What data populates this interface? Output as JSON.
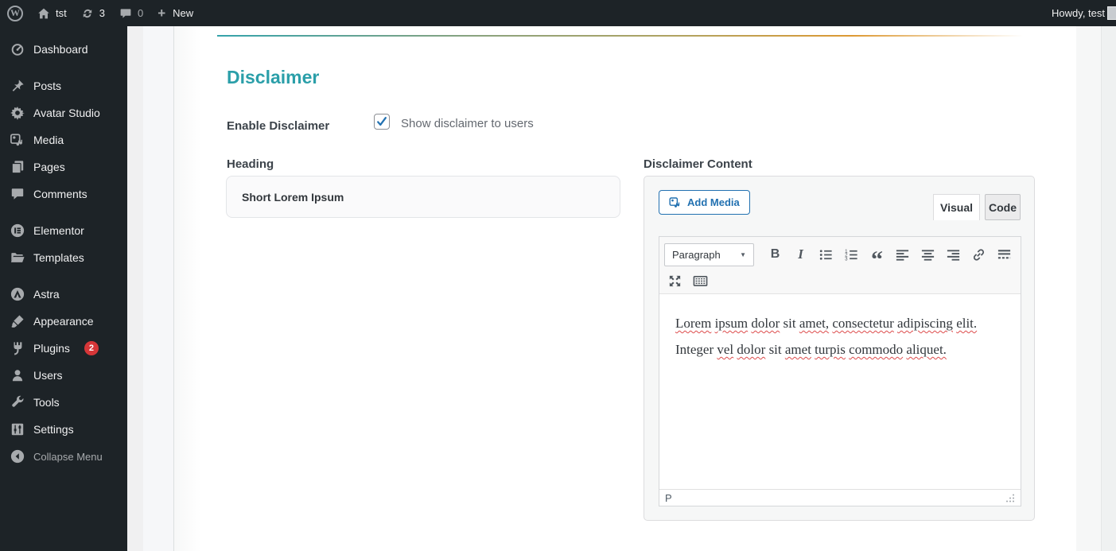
{
  "admin_bar": {
    "site_name": "tst",
    "updates_count": "3",
    "comments_count": "0",
    "new_label": "New",
    "howdy": "Howdy, test"
  },
  "sidebar": {
    "items": [
      {
        "label": "Dashboard",
        "icon": "dashboard",
        "slug": "dashboard"
      },
      {
        "label": "Posts",
        "icon": "pin",
        "slug": "posts",
        "sep": true
      },
      {
        "label": "Avatar Studio",
        "icon": "gear",
        "slug": "avatar-studio"
      },
      {
        "label": "Media",
        "icon": "media",
        "slug": "media"
      },
      {
        "label": "Pages",
        "icon": "pages",
        "slug": "pages"
      },
      {
        "label": "Comments",
        "icon": "comment",
        "slug": "comments"
      },
      {
        "label": "Elementor",
        "icon": "elementor",
        "slug": "elementor",
        "sep": true
      },
      {
        "label": "Templates",
        "icon": "folder",
        "slug": "templates"
      },
      {
        "label": "Astra",
        "icon": "astra",
        "slug": "astra",
        "sep": true
      },
      {
        "label": "Appearance",
        "icon": "brush",
        "slug": "appearance"
      },
      {
        "label": "Plugins",
        "icon": "plug",
        "slug": "plugins",
        "badge": "2"
      },
      {
        "label": "Users",
        "icon": "user",
        "slug": "users"
      },
      {
        "label": "Tools",
        "icon": "wrench",
        "slug": "tools"
      },
      {
        "label": "Settings",
        "icon": "sliders",
        "slug": "settings"
      },
      {
        "label": "Collapse Menu",
        "icon": "collapse",
        "slug": "collapse-menu",
        "muted": true
      }
    ]
  },
  "panel": {
    "title": "Disclaimer",
    "enable_field": {
      "label": "Enable Disclaimer",
      "checkbox_label": "Show disclaimer to users",
      "checked": true
    },
    "heading_field": {
      "label": "Heading",
      "value": "Short Lorem Ipsum"
    },
    "content_field": {
      "label": "Disclaimer Content",
      "add_media_label": "Add Media",
      "tab_visual": "Visual",
      "tab_code": "Code",
      "active_tab": "Visual",
      "block_format": "Paragraph",
      "bold_glyph": "B",
      "italic_glyph": "I",
      "status_path": "P",
      "text": "Lorem ipsum dolor sit amet, consectetur adipiscing elit. Integer vel dolor sit amet turpis commodo aliquet.",
      "words": [
        {
          "t": "Lorem",
          "m": true
        },
        {
          "t": "ipsum",
          "m": true
        },
        {
          "t": "dolor",
          "m": true
        },
        {
          "t": "sit",
          "m": false
        },
        {
          "t": "amet,",
          "m": true
        },
        {
          "t": "consectetur",
          "m": true
        },
        {
          "t": "adipiscing",
          "m": true
        },
        {
          "t": "elit.",
          "m": true
        },
        {
          "t": "Integer",
          "m": false
        },
        {
          "t": "vel",
          "m": true
        },
        {
          "t": "dolor",
          "m": true
        },
        {
          "t": "sit",
          "m": false
        },
        {
          "t": "amet",
          "m": true
        },
        {
          "t": "turpis",
          "m": true
        },
        {
          "t": "commodo",
          "m": true
        },
        {
          "t": "aliquet.",
          "m": true
        }
      ]
    }
  },
  "colors": {
    "accent_teal": "#2b9fa9",
    "admin_blue": "#2271b1",
    "badge_red": "#d63638",
    "dark_bg": "#1d2327"
  }
}
